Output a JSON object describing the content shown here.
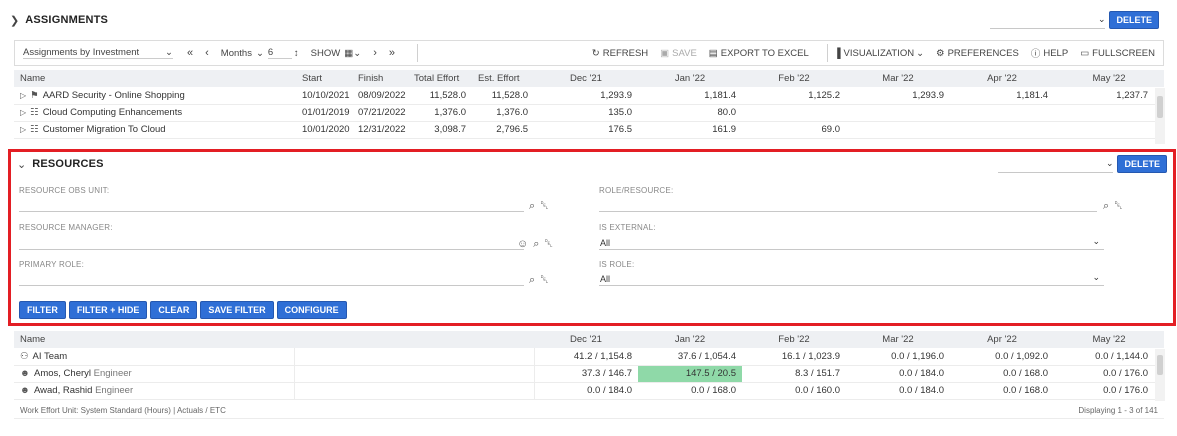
{
  "assignments": {
    "title": "ASSIGNMENTS",
    "delete_label": "DELETE",
    "toolbar": {
      "view_select": "Assignments by Investment",
      "months_label": "Months",
      "months_value": "6",
      "show_label": "SHOW",
      "refresh": "REFRESH",
      "save": "SAVE",
      "export": "EXPORT TO EXCEL",
      "visualization": "VISUALIZATION",
      "preferences": "PREFERENCES",
      "help": "HELP",
      "fullscreen": "FULLSCREEN"
    },
    "columns": [
      "Name",
      "Start",
      "Finish",
      "Total Effort",
      "Est. Effort",
      "Dec '21",
      "Jan '22",
      "Feb '22",
      "Mar '22",
      "Apr '22",
      "May '22"
    ],
    "rows": [
      {
        "name": "AARD Security - Online Shopping",
        "start": "10/10/2021",
        "finish": "08/09/2022",
        "total": "11,528.0",
        "est": "11,528.0",
        "m": [
          "1,293.9",
          "1,181.4",
          "1,125.2",
          "1,293.9",
          "1,181.4",
          "1,237.7"
        ]
      },
      {
        "name": "Cloud Computing Enhancements",
        "start": "01/01/2019",
        "finish": "07/21/2022",
        "total": "1,376.0",
        "est": "1,376.0",
        "m": [
          "135.0",
          "80.0",
          "",
          "",
          "",
          ""
        ]
      },
      {
        "name": "Customer Migration To Cloud",
        "start": "10/01/2020",
        "finish": "12/31/2022",
        "total": "3,098.7",
        "est": "2,796.5",
        "m": [
          "176.5",
          "161.9",
          "69.0",
          "",
          "",
          ""
        ]
      }
    ]
  },
  "resources": {
    "title": "RESOURCES",
    "delete_label": "DELETE",
    "fields": {
      "obs_unit": "RESOURCE OBS UNIT:",
      "role_resource": "ROLE/RESOURCE:",
      "manager": "RESOURCE MANAGER:",
      "is_external": "IS EXTERNAL:",
      "is_external_value": "All",
      "primary_role": "PRIMARY ROLE:",
      "is_role": "IS ROLE:",
      "is_role_value": "All"
    },
    "buttons": {
      "filter": "FILTER",
      "filter_hide": "FILTER + HIDE",
      "clear": "CLEAR",
      "save_filter": "SAVE FILTER",
      "configure": "CONFIGURE"
    }
  },
  "resource_grid": {
    "columns": [
      "Name",
      "Dec '21",
      "Jan '22",
      "Feb '22",
      "Mar '22",
      "Apr '22",
      "May '22"
    ],
    "rows": [
      {
        "name": "AI Team",
        "role": "",
        "m": [
          "41.2 / 1,154.8",
          "37.6 / 1,054.4",
          "16.1 / 1,023.9",
          "0.0 / 1,196.0",
          "0.0 / 1,092.0",
          "0.0 / 1,144.0"
        ]
      },
      {
        "name": "Amos, Cheryl",
        "role": "Engineer",
        "m": [
          "37.3 / 146.7",
          "147.5 / 20.5",
          "8.3 / 151.7",
          "0.0 / 184.0",
          "0.0 / 168.0",
          "0.0 / 176.0"
        ]
      },
      {
        "name": "Awad, Rashid",
        "role": "Engineer",
        "m": [
          "0.0 / 184.0",
          "0.0 / 168.0",
          "0.0 / 160.0",
          "0.0 / 184.0",
          "0.0 / 168.0",
          "0.0 / 176.0"
        ]
      }
    ],
    "footer_left": "Work Effort Unit: System Standard (Hours) | Actuals / ETC",
    "footer_right": "Displaying 1 - 3 of 141"
  },
  "colors": {
    "accent": "#2f6fd6",
    "highlight_border": "#e31e24",
    "over_allocation": "#8fd9a8"
  }
}
